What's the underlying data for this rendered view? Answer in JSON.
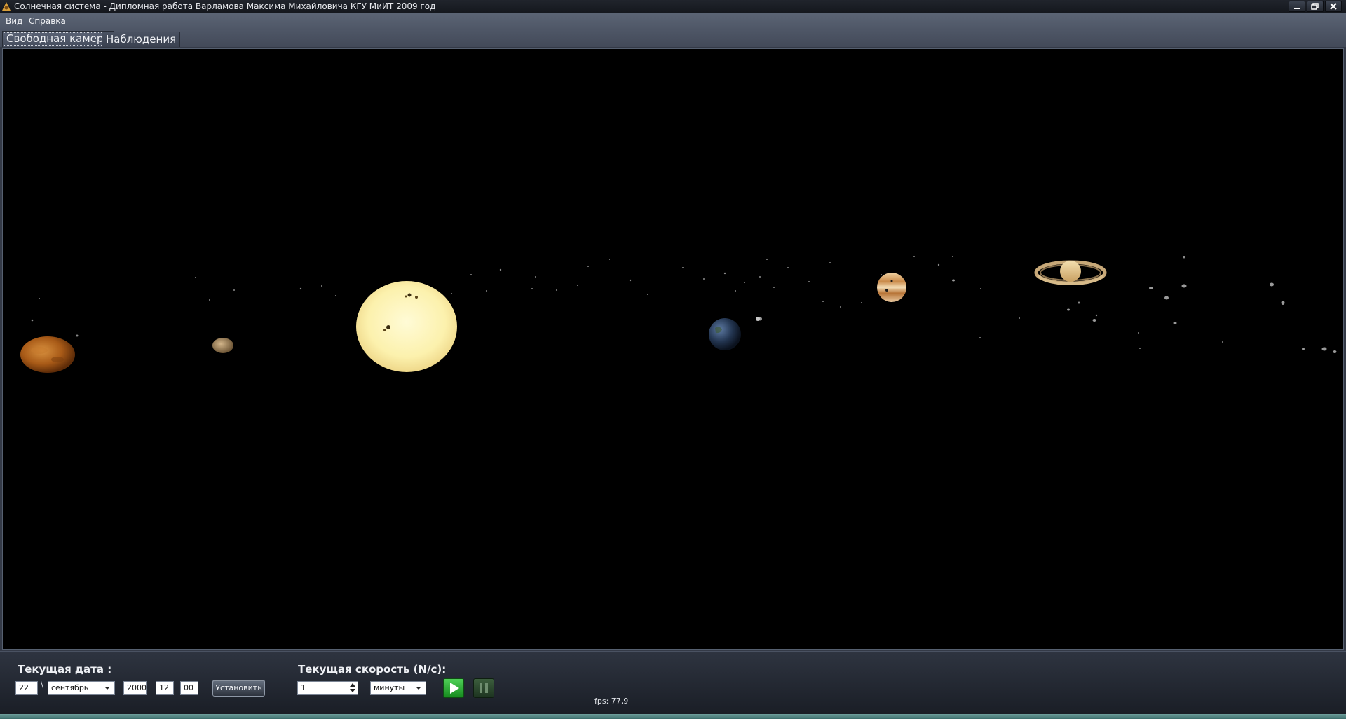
{
  "window": {
    "title": "Солнечная система - Дипломная работа Варламова Максима Михайловича КГУ МиИТ 2009 год",
    "controls": [
      "minimize-icon",
      "restore-icon",
      "close-icon"
    ]
  },
  "menu": {
    "items": [
      {
        "label": "Вид"
      },
      {
        "label": "Справка"
      }
    ]
  },
  "tabs": [
    {
      "label": "Свободная камера",
      "active": true
    },
    {
      "label": "Наблюдения",
      "active": false
    }
  ],
  "scene": {
    "background": "#000000",
    "bodies": [
      "mars",
      "mercury",
      "sun",
      "earth",
      "moon",
      "jupiter",
      "saturn"
    ],
    "colors": {
      "sun": "#fdf6b6",
      "mars": "#b5661d",
      "mercury": "#a98a60",
      "earth": "#2c3f5e",
      "jupiter": "#d9a66a",
      "saturn": "#e6c890"
    }
  },
  "date_panel": {
    "label": "Текущая дата :",
    "day": "22",
    "separator": "\\",
    "month": "сентябрь",
    "year": "2000",
    "hour": "12",
    "minute": "00",
    "set_button": "Установить"
  },
  "speed_panel": {
    "label": "Текущая скорость (N/с):",
    "value": "1",
    "unit": "минуты",
    "play_icon": "play-icon",
    "pause_icon": "pause-icon"
  },
  "status": {
    "fps": "fps: 77,9"
  },
  "colors": {
    "accent_play": "#27a52f",
    "accent_pause": "#2b4a2c",
    "chrome": "#4f5767"
  }
}
